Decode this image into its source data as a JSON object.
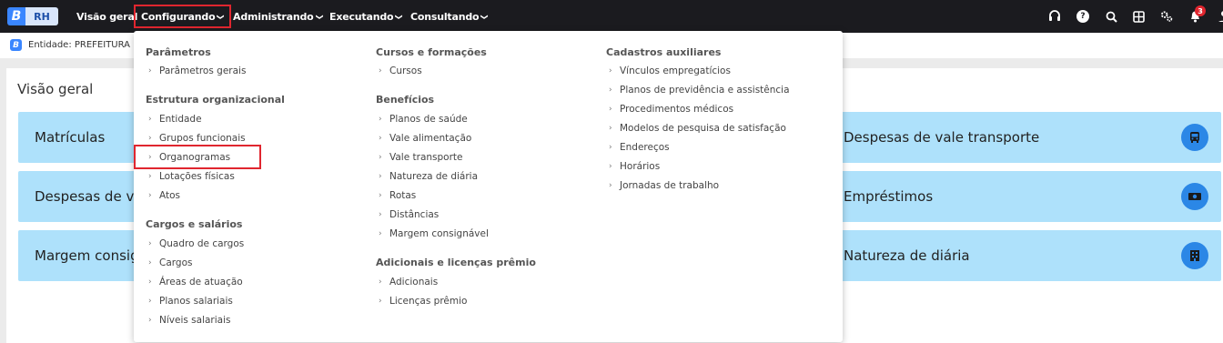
{
  "topbar": {
    "logo_letter": "B",
    "logo_app": "RH",
    "nav": [
      {
        "label": "Visão geral",
        "chevron": false
      },
      {
        "label": "Configurando",
        "chevron": true,
        "active": true
      },
      {
        "label": "Administrando",
        "chevron": true
      },
      {
        "label": "Executando",
        "chevron": true
      },
      {
        "label": "Consultando",
        "chevron": true
      }
    ],
    "chevron_glyph": "❯",
    "notification_count": "3",
    "icons": [
      "headset-icon",
      "help-icon",
      "search-icon",
      "grid-icon",
      "settings-icon",
      "bell-icon",
      "user-icon"
    ]
  },
  "entity": {
    "icon_letter": "B",
    "text": "Entidade: PREFEITURA D"
  },
  "main": {
    "title": "Visão geral",
    "cards_left": [
      "Matrículas",
      "Despesas de val",
      "Margem consigr"
    ],
    "cards_right": [
      {
        "label": "Despesas de vale transporte",
        "icon": "bus-icon"
      },
      {
        "label": "Empréstimos",
        "icon": "money-icon"
      },
      {
        "label": "Natureza de diária",
        "icon": "building-icon"
      }
    ]
  },
  "menu": {
    "arrow": "›",
    "col1": {
      "s1": {
        "title": "Parâmetros",
        "items": [
          "Parâmetros gerais"
        ]
      },
      "s2": {
        "title": "Estrutura organizacional",
        "items": [
          "Entidade",
          "Grupos funcionais",
          "Organogramas",
          "Lotações físicas",
          "Atos"
        ]
      },
      "s3": {
        "title": "Cargos e salários",
        "items": [
          "Quadro de cargos",
          "Cargos",
          "Áreas de atuação",
          "Planos salariais",
          "Níveis salariais"
        ]
      }
    },
    "col2": {
      "s1": {
        "title": "Cursos e formações",
        "items": [
          "Cursos"
        ]
      },
      "s2": {
        "title": "Benefícios",
        "items": [
          "Planos de saúde",
          "Vale alimentação",
          "Vale transporte",
          "Natureza de diária",
          "Rotas",
          "Distâncias",
          "Margem consignável"
        ]
      },
      "s3": {
        "title": "Adicionais e licenças prêmio",
        "items": [
          "Adicionais",
          "Licenças prêmio"
        ]
      }
    },
    "col3": {
      "s1": {
        "title": "Cadastros auxiliares",
        "items": [
          "Vínculos empregatícios",
          "Planos de previdência e assistência",
          "Procedimentos médicos",
          "Modelos de pesquisa de satisfação",
          "Endereços",
          "Horários",
          "Jornadas de trabalho"
        ]
      }
    }
  }
}
